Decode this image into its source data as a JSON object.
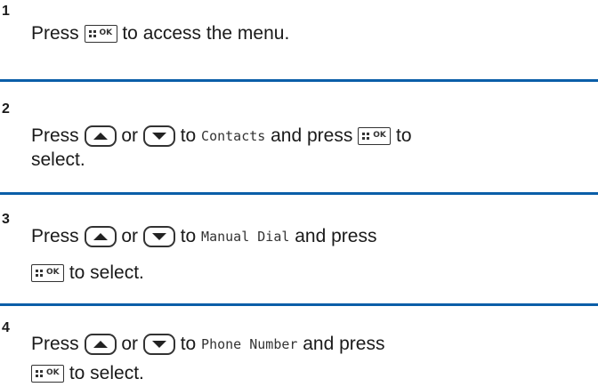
{
  "steps": [
    {
      "number": "1",
      "line1": {
        "pre": "Press ",
        "post": " to access the menu."
      }
    },
    {
      "number": "2",
      "line1": {
        "pre": "Press ",
        "or": " or ",
        "to": " to ",
        "item": "Contacts",
        "and_press": " and press ",
        "post": " to"
      },
      "line2": {
        "text": "select."
      }
    },
    {
      "number": "3",
      "line1": {
        "pre": "Press ",
        "or": " or ",
        "to": " to ",
        "item": "Manual Dial",
        "post": " and press"
      },
      "line2": {
        "post": " to select."
      }
    },
    {
      "number": "4",
      "line1": {
        "pre": "Press ",
        "or": " or ",
        "to": " to ",
        "item": "Phone Number",
        "post": " and press"
      },
      "line2": {
        "post": " to select."
      }
    }
  ],
  "icons": {
    "menu_ok_key": "menu-ok-key-icon",
    "up_key": "up-arrow-key-icon",
    "down_key": "down-arrow-key-icon",
    "ok_text": "OK"
  },
  "colors": {
    "divider": "#0a5ea8",
    "text": "#1a1a1a"
  }
}
